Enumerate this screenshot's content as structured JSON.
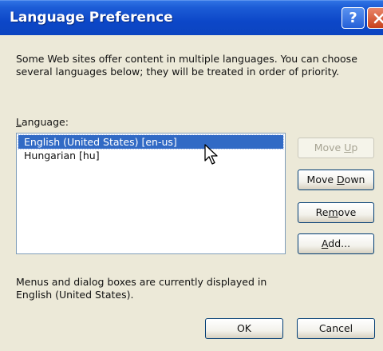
{
  "window": {
    "title": "Language Preference",
    "help_glyph": "?"
  },
  "description": "Some Web sites offer content in multiple languages. You can choose several languages below; they will be treated in order of priority.",
  "language_label": {
    "mnemonic": "L",
    "rest": "anguage:"
  },
  "languages": [
    {
      "label": "English (United States) [en-us]",
      "selected": true
    },
    {
      "label": "Hungarian [hu]",
      "selected": false
    }
  ],
  "buttons": {
    "move_up": {
      "pre": "Move ",
      "mnemonic": "U",
      "post": "p",
      "enabled": false
    },
    "move_down": {
      "pre": "Move ",
      "mnemonic": "D",
      "post": "own",
      "enabled": true
    },
    "remove": {
      "pre": "Re",
      "mnemonic": "m",
      "post": "ove",
      "enabled": true
    },
    "add": {
      "pre": "",
      "mnemonic": "A",
      "post": "dd...",
      "enabled": true
    },
    "ok": "OK",
    "cancel": "Cancel"
  },
  "status_text": "Menus and dialog boxes are currently displayed in English (United States).",
  "colors": {
    "titlebar": "#0c47c8",
    "selection": "#316ac5",
    "dialog_bg": "#ece9d8",
    "close_button": "#c8401b"
  }
}
